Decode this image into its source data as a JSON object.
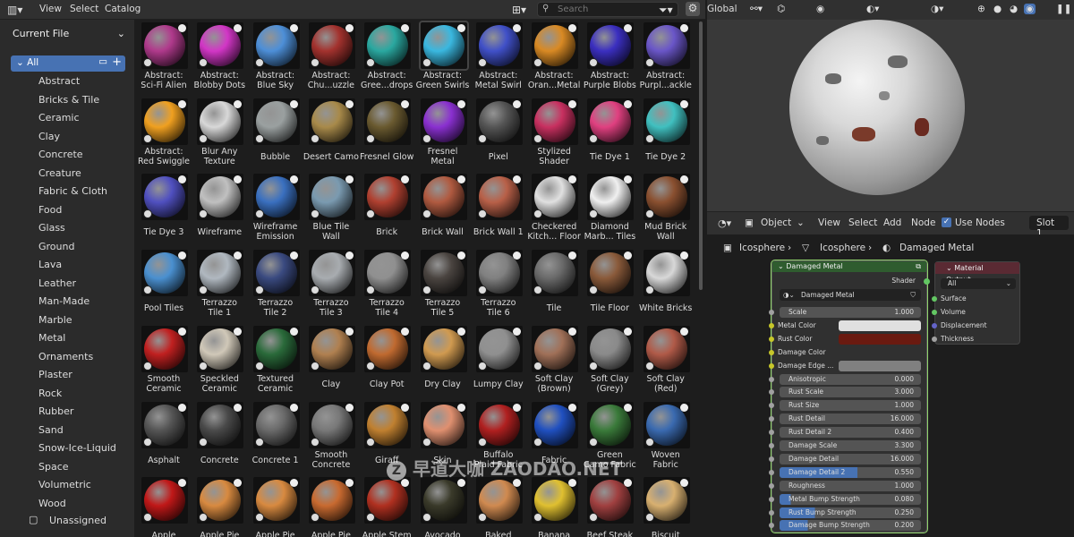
{
  "header": {
    "menus": [
      "View",
      "Select",
      "Catalog"
    ],
    "search_placeholder": "Search"
  },
  "viewport_header": {
    "transform": "Global"
  },
  "sidebar": {
    "library": "Current File",
    "all_label": "All",
    "categories": [
      "Abstract",
      "Bricks & Tile",
      "Ceramic",
      "Clay",
      "Concrete",
      "Creature",
      "Fabric & Cloth",
      "Food",
      "Glass",
      "Ground",
      "Lava",
      "Leather",
      "Man-Made",
      "Marble",
      "Metal",
      "Ornaments",
      "Plaster",
      "Rock",
      "Rubber",
      "Sand",
      "Snow-Ice-Liquid",
      "Space",
      "Volumetric",
      "Wood"
    ],
    "unassigned": "Unassigned"
  },
  "assets": [
    {
      "l1": "Abstract:",
      "l2": "Sci-Fi Alien",
      "c": "#b03a8c"
    },
    {
      "l1": "Abstract:",
      "l2": "Blobby Dots",
      "c": "#d236c6"
    },
    {
      "l1": "Abstract:",
      "l2": "Blue Sky",
      "c": "#4d8fd8"
    },
    {
      "l1": "Abstract:",
      "l2": "Chu...uzzle",
      "c": "#a3322e"
    },
    {
      "l1": "Abstract:",
      "l2": "Gree...drops",
      "c": "#2aa8a0"
    },
    {
      "l1": "Abstract:",
      "l2": "Green Swirls",
      "c": "#3ab8e0"
    },
    {
      "l1": "Abstract:",
      "l2": "Metal Swirl",
      "c": "#4050c8"
    },
    {
      "l1": "Abstract:",
      "l2": "Oran...Metal",
      "c": "#d98a24"
    },
    {
      "l1": "Abstract:",
      "l2": "Purple Blobs",
      "c": "#3b2fc0"
    },
    {
      "l1": "Abstract:",
      "l2": "Purpl...ackle",
      "c": "#6a56c8"
    },
    {
      "l1": "Abstract:",
      "l2": "Red Swiggle",
      "c": "#f0a020"
    },
    {
      "l1": "Blur Any",
      "l2": "Texture",
      "c": "#d8d8d8"
    },
    {
      "l1": "",
      "l2": "Bubble",
      "c": "#9aa0a0"
    },
    {
      "l1": "",
      "l2": "Desert Camo",
      "c": "#a88a4a"
    },
    {
      "l1": "",
      "l2": "Fresnel Glow",
      "c": "#6a5a30"
    },
    {
      "l1": "Fresnel",
      "l2": "Metal",
      "c": "#8a30d0"
    },
    {
      "l1": "",
      "l2": "Pixel",
      "c": "#555555"
    },
    {
      "l1": "Stylized",
      "l2": "Shader",
      "c": "#c83060"
    },
    {
      "l1": "",
      "l2": "Tie Dye 1",
      "c": "#e04080"
    },
    {
      "l1": "",
      "l2": "Tie Dye 2",
      "c": "#40c0c0"
    },
    {
      "l1": "",
      "l2": "Tie Dye 3",
      "c": "#5050c0"
    },
    {
      "l1": "",
      "l2": "Wireframe",
      "c": "#c0c0c0"
    },
    {
      "l1": "Wireframe",
      "l2": "Emission",
      "c": "#3a70c0"
    },
    {
      "l1": "Blue Tile",
      "l2": "Wall",
      "c": "#7a9ab0"
    },
    {
      "l1": "",
      "l2": "Brick",
      "c": "#b04030"
    },
    {
      "l1": "",
      "l2": "Brick Wall",
      "c": "#b05a40"
    },
    {
      "l1": "",
      "l2": "Brick Wall 1",
      "c": "#b86048"
    },
    {
      "l1": "Checkered",
      "l2": "Kitch... Floor",
      "c": "#e0e0e0"
    },
    {
      "l1": "Diamond",
      "l2": "Marb... Tiles",
      "c": "#f0f0f0"
    },
    {
      "l1": "Mud Brick",
      "l2": "Wall",
      "c": "#8a5030"
    },
    {
      "l1": "",
      "l2": "Pool Tiles",
      "c": "#4a90d0"
    },
    {
      "l1": "Terrazzo",
      "l2": "Tile 1",
      "c": "#b0b8c0"
    },
    {
      "l1": "Terrazzo",
      "l2": "Tile 2",
      "c": "#3a4a80"
    },
    {
      "l1": "Terrazzo",
      "l2": "Tile 3",
      "c": "#a8acb0"
    },
    {
      "l1": "Terrazzo",
      "l2": "Tile 4",
      "c": "#909090"
    },
    {
      "l1": "Terrazzo",
      "l2": "Tile 5",
      "c": "#4a4440"
    },
    {
      "l1": "Terrazzo",
      "l2": "Tile 6",
      "c": "#808080"
    },
    {
      "l1": "",
      "l2": "Tile",
      "c": "#6a6a6a"
    },
    {
      "l1": "",
      "l2": "Tile Floor",
      "c": "#8a5a3a"
    },
    {
      "l1": "",
      "l2": "White Bricks",
      "c": "#d8d8d8"
    },
    {
      "l1": "Smooth",
      "l2": "Ceramic",
      "c": "#c02020"
    },
    {
      "l1": "Speckled",
      "l2": "Ceramic",
      "c": "#d0c8b8"
    },
    {
      "l1": "Textured",
      "l2": "Ceramic",
      "c": "#2a6a3a"
    },
    {
      "l1": "",
      "l2": "Clay",
      "c": "#b08050"
    },
    {
      "l1": "",
      "l2": "Clay Pot",
      "c": "#c06a30"
    },
    {
      "l1": "",
      "l2": "Dry Clay",
      "c": "#d09a50"
    },
    {
      "l1": "",
      "l2": "Lumpy Clay",
      "c": "#909090"
    },
    {
      "l1": "Soft Clay",
      "l2": "(Brown)",
      "c": "#a07058"
    },
    {
      "l1": "Soft Clay",
      "l2": "(Grey)",
      "c": "#8a8a8a"
    },
    {
      "l1": "Soft Clay",
      "l2": "(Red)",
      "c": "#b05a48"
    },
    {
      "l1": "",
      "l2": "Asphalt",
      "c": "#555555"
    },
    {
      "l1": "",
      "l2": "Concrete",
      "c": "#4a4a4a"
    },
    {
      "l1": "",
      "l2": "Concrete 1",
      "c": "#6a6a6a"
    },
    {
      "l1": "Smooth",
      "l2": "Concrete",
      "c": "#787878"
    },
    {
      "l1": "",
      "l2": "Giraff",
      "c": "#c08030"
    },
    {
      "l1": "",
      "l2": "Skin",
      "c": "#e09070"
    },
    {
      "l1": "Buffalo",
      "l2": "Plaid Fabric",
      "c": "#b02020"
    },
    {
      "l1": "",
      "l2": "Fabric",
      "c": "#2050c0"
    },
    {
      "l1": "Green",
      "l2": "Camo Fabric",
      "c": "#3a7a3a"
    },
    {
      "l1": "Woven",
      "l2": "Fabric",
      "c": "#3a6ab0"
    },
    {
      "l1": "",
      "l2": "Apple",
      "c": "#c01818"
    },
    {
      "l1": "",
      "l2": "Apple Pie",
      "c": "#d88a40"
    },
    {
      "l1": "",
      "l2": "Apple Pie",
      "c": "#d88a40"
    },
    {
      "l1": "",
      "l2": "Apple Pie",
      "c": "#c86a30"
    },
    {
      "l1": "",
      "l2": "Apple Stem",
      "c": "#b03020"
    },
    {
      "l1": "",
      "l2": "Avocado",
      "c": "#3a3a2a"
    },
    {
      "l1": "",
      "l2": "Baked",
      "c": "#d08a50"
    },
    {
      "l1": "",
      "l2": "Banana",
      "c": "#e0c030"
    },
    {
      "l1": "",
      "l2": "Beef Steak",
      "c": "#a04040"
    },
    {
      "l1": "",
      "l2": "Biscuit",
      "c": "#d8b070"
    }
  ],
  "node_editor": {
    "object_menu": "Object",
    "menus": [
      "View",
      "Select",
      "Add",
      "Node"
    ],
    "use_nodes": "Use Nodes",
    "slot": "Slot 1",
    "breadcrumb": [
      "Icosphere",
      "Icosphere",
      "Damaged Metal"
    ]
  },
  "node": {
    "title": "Damaged Metal",
    "shader": "Shader",
    "group": "Damaged Metal",
    "inputs": [
      {
        "name": "Scale",
        "value": "1.000",
        "type": "field"
      },
      {
        "name": "Metal Color",
        "type": "color",
        "color": "#e0e0e0"
      },
      {
        "name": "Rust Color",
        "type": "color",
        "color": "#6a1a10"
      },
      {
        "name": "Damage Color",
        "type": "label"
      },
      {
        "name": "Damage Edge ...",
        "type": "color",
        "color": "#808080"
      },
      {
        "name": "Anisotropic",
        "value": "0.000",
        "type": "field"
      },
      {
        "name": "Rust Scale",
        "value": "3.000",
        "type": "field"
      },
      {
        "name": "Rust Size",
        "value": "1.000",
        "type": "field"
      },
      {
        "name": "Rust Detail",
        "value": "16.000",
        "type": "field"
      },
      {
        "name": "Rust Detail 2",
        "value": "0.400",
        "type": "field"
      },
      {
        "name": "Damage Scale",
        "value": "3.300",
        "type": "field"
      },
      {
        "name": "Damage Detail",
        "value": "16.000",
        "type": "field"
      },
      {
        "name": "Damage Detail 2",
        "value": "0.550",
        "type": "slider",
        "fill": 0.55
      },
      {
        "name": "Roughness",
        "value": "1.000",
        "type": "field"
      },
      {
        "name": "Metal Bump Strength",
        "value": "0.080",
        "type": "slider",
        "fill": 0.08
      },
      {
        "name": "Rust Bump Strength",
        "value": "0.250",
        "type": "slider",
        "fill": 0.25
      },
      {
        "name": "Damage Bump Strength",
        "value": "0.200",
        "type": "slider",
        "fill": 0.2
      }
    ]
  },
  "output_node": {
    "title": "Material Output",
    "target": "All",
    "sockets": [
      "Surface",
      "Volume",
      "Displacement",
      "Thickness"
    ]
  },
  "watermark": "早道大咖 ZAODAO.NET"
}
